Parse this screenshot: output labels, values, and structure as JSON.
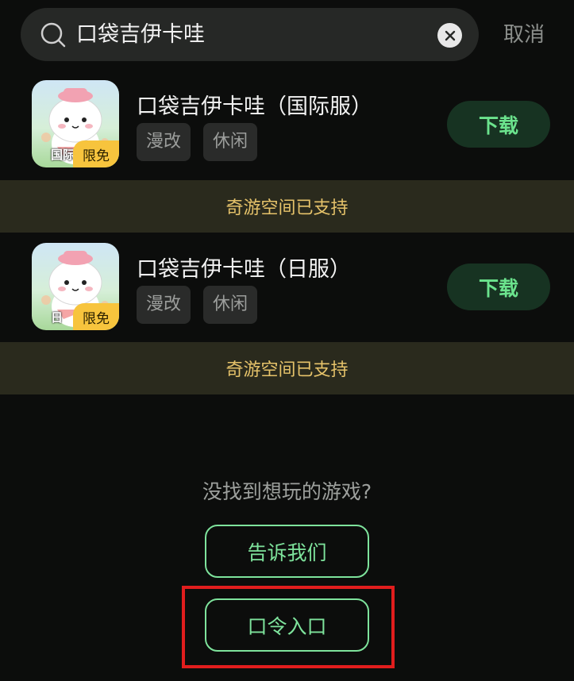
{
  "search": {
    "query": "口袋吉伊卡哇",
    "cancel_label": "取消"
  },
  "results": [
    {
      "title": "口袋吉伊卡哇（国际服）",
      "region_tag": "国际",
      "badge": "限免",
      "tags": [
        "漫改",
        "休闲"
      ],
      "download_label": "下载",
      "support_text": "奇游空间已支持"
    },
    {
      "title": "口袋吉伊卡哇（日服）",
      "region_tag": "日",
      "badge": "限免",
      "tags": [
        "漫改",
        "休闲"
      ],
      "download_label": "下载",
      "support_text": "奇游空间已支持"
    }
  ],
  "footer": {
    "prompt": "没找到想玩的游戏?",
    "tell_us_label": "告诉我们",
    "code_entry_label": "口令入口"
  },
  "colors": {
    "background": "#0c0d0c",
    "accent_green": "#6be38d",
    "banner_text": "#e6c36a",
    "badge_yellow": "#f7c43d",
    "highlight_red": "#e11d1d"
  }
}
